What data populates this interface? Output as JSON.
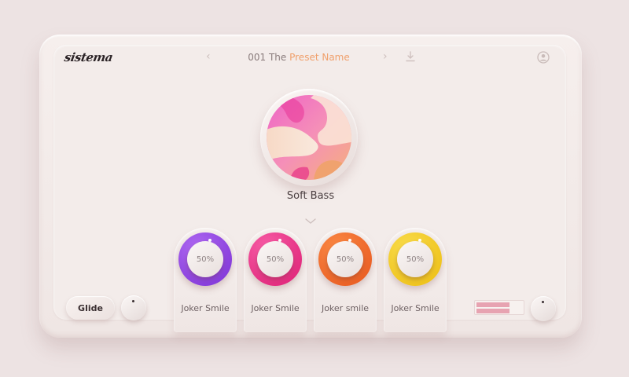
{
  "brand": {
    "name": "sistema"
  },
  "header": {
    "preset_prefix": "001 The ",
    "preset_accent": "Preset Name",
    "icons": [
      "chevron-left-icon",
      "chevron-right-icon",
      "download-icon",
      "user-icon"
    ]
  },
  "patch": {
    "name": "Soft Bass"
  },
  "macros": [
    {
      "label": "Joker Smile",
      "value": "50%",
      "color": "#8a3fe0"
    },
    {
      "label": "Joker Smile",
      "value": "50%",
      "color": "#ee2f86"
    },
    {
      "label": "Joker smile",
      "value": "50%",
      "color": "#f26a2c"
    },
    {
      "label": "Joker Smile",
      "value": "50%",
      "color": "#f2cb1c"
    }
  ],
  "controls": {
    "glide_label": "Glide",
    "meter_levels": [
      0.72,
      0.72
    ]
  },
  "colors": {
    "accent": "#f0a06c",
    "meter": "#e7a3b1"
  }
}
